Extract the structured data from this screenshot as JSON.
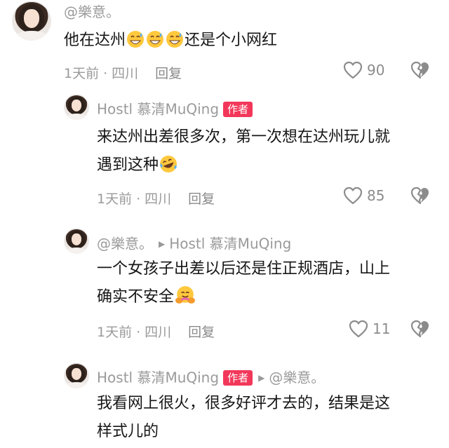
{
  "comments": [
    {
      "username": "@樂意。",
      "text": "他在达州",
      "text_after_emoji": "还是个小网红",
      "time": "1天前",
      "location": "四川",
      "reply_label": "回复",
      "likes": "90"
    },
    {
      "username": "Hostl 慕清MuQing",
      "author_tag": "作者",
      "text_line1": "来达州出差很多次，第一次想在达州玩儿就",
      "text_line2": "遇到这种",
      "time": "1天前",
      "location": "四川",
      "reply_label": "回复",
      "likes": "85"
    },
    {
      "username": "@樂意。",
      "reply_to": "Hostl 慕清MuQing",
      "text_line1": "一个女孩子出差以后还是住正规酒店，山上",
      "text_line2": "确实不安全",
      "time": "1天前",
      "location": "四川",
      "reply_label": "回复",
      "likes": "11"
    },
    {
      "username": "Hostl 慕清MuQing",
      "author_tag": "作者",
      "reply_to": "@樂意。",
      "text_line1": "我看网上很火，很多好评才去的，结果是这",
      "text_line2": "样式儿的"
    }
  ],
  "colors": {
    "author_tag": "#f2385a",
    "meta_gray": "#9a9a9a"
  },
  "icons": [
    "heart-outline-icon",
    "broken-heart-icon",
    "play-arrow-icon",
    "grinning-sweat-emoji",
    "laughing-tears-emoji",
    "hug-emoji"
  ]
}
